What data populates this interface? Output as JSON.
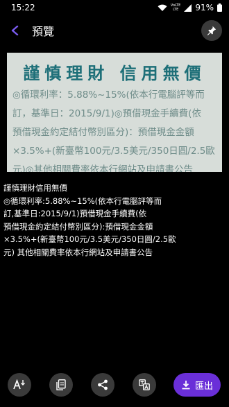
{
  "status": {
    "time": "15:22",
    "volte": "VoLTE",
    "lte": "LTE",
    "battery": "91%"
  },
  "header": {
    "title": "預覽"
  },
  "preview": {
    "heading": "謹慎理財 信用無價",
    "lines": [
      "◎循環利率：5.88%~15%(依本行電腦評等而",
      "訂，基準日：2015/9/1)◎預借現金手續費(依",
      "預借現金約定結付幣別區分)：預借現金金額",
      "×3.5%+(新臺幣100元/3.5美元/350日圓/2.5歐",
      "元)◎其他相關費率依本行網站及申請書公告"
    ]
  },
  "result_text": [
    "謹慎理財信用無價",
    "◎循環利率:5.88%~15%(依本行電腦評等而",
    "訂,基準日:2015/9/1)預借現金手續費(依",
    "預借現金約定結付幣別區分):預借現金金額",
    "×3.5%+(新臺幣100元/3.5美元/350日圓/2.5歐",
    "元) 其他相關費率依本行網站及申請書公告"
  ],
  "actions": {
    "export_label": "匯出"
  }
}
